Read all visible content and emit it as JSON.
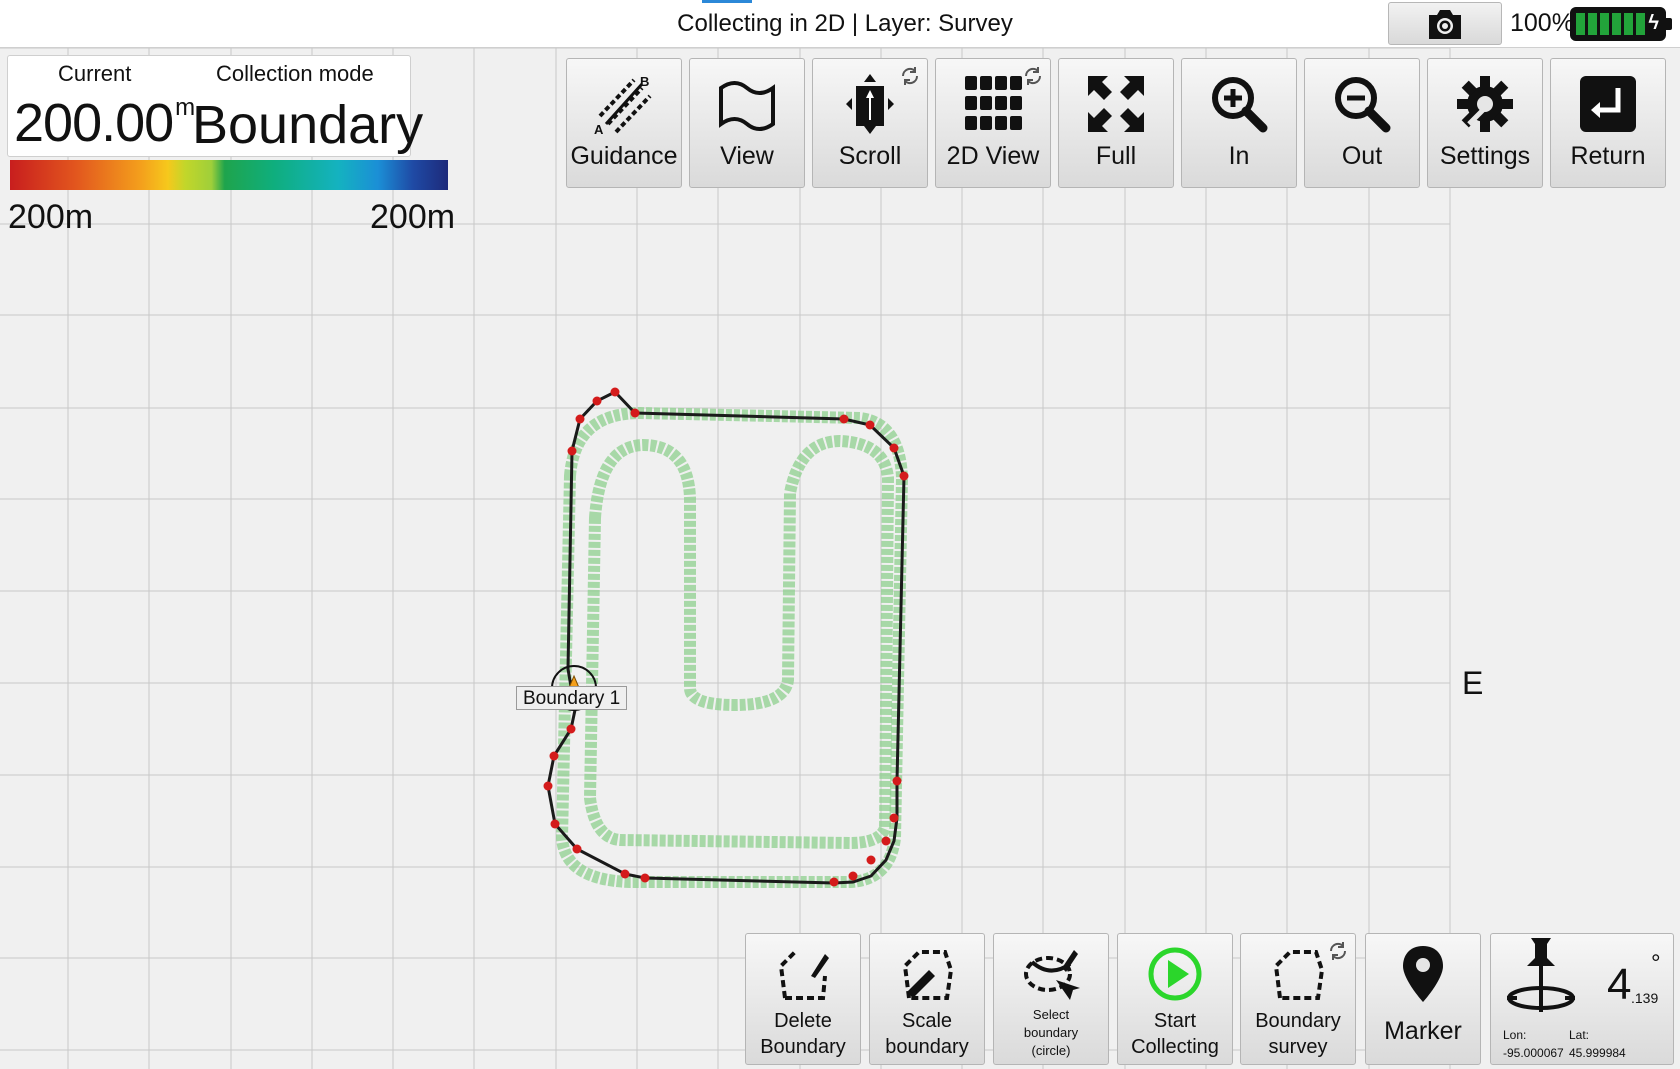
{
  "window": {
    "title": "Collecting in 2D | Layer: Survey",
    "battery_percent": "100%",
    "battery_level": 1.0
  },
  "info_panel": {
    "current_label": "Current",
    "current_value": "200.00",
    "current_unit": "m",
    "mode_label": "Collection mode",
    "mode_value": "Boundary"
  },
  "legend": {
    "min": "200m",
    "max": "200m"
  },
  "toolbar": {
    "guidance": "Guidance",
    "view": "View",
    "scroll": "Scroll",
    "view2d": "2D View",
    "full": "Full",
    "zoom_in": "In",
    "zoom_out": "Out",
    "settings": "Settings",
    "return": "Return"
  },
  "bottom_bar": {
    "delete_boundary": "Delete\nBoundary",
    "scale_boundary": "Scale\nboundary",
    "select_boundary": "Select\nboundary\n(circle)",
    "start_collecting": "Start\nCollecting",
    "boundary_survey": "Boundary\nsurvey",
    "marker": "Marker"
  },
  "gps": {
    "degree": "4",
    "degree_fraction": ".139",
    "degree_symbol": "°",
    "lon_label": "Lon:",
    "lon_value": "-95.000067",
    "lat_label": "Lat:",
    "lat_value": "45.999984"
  },
  "map": {
    "compass_label": "E",
    "boundary_label": "Boundary 1"
  },
  "colors": {
    "boundary_line": "#1a1a1a",
    "vertex": "#d41b1b",
    "coverage": "#8fd08f",
    "play_icon": "#2bd62b"
  }
}
